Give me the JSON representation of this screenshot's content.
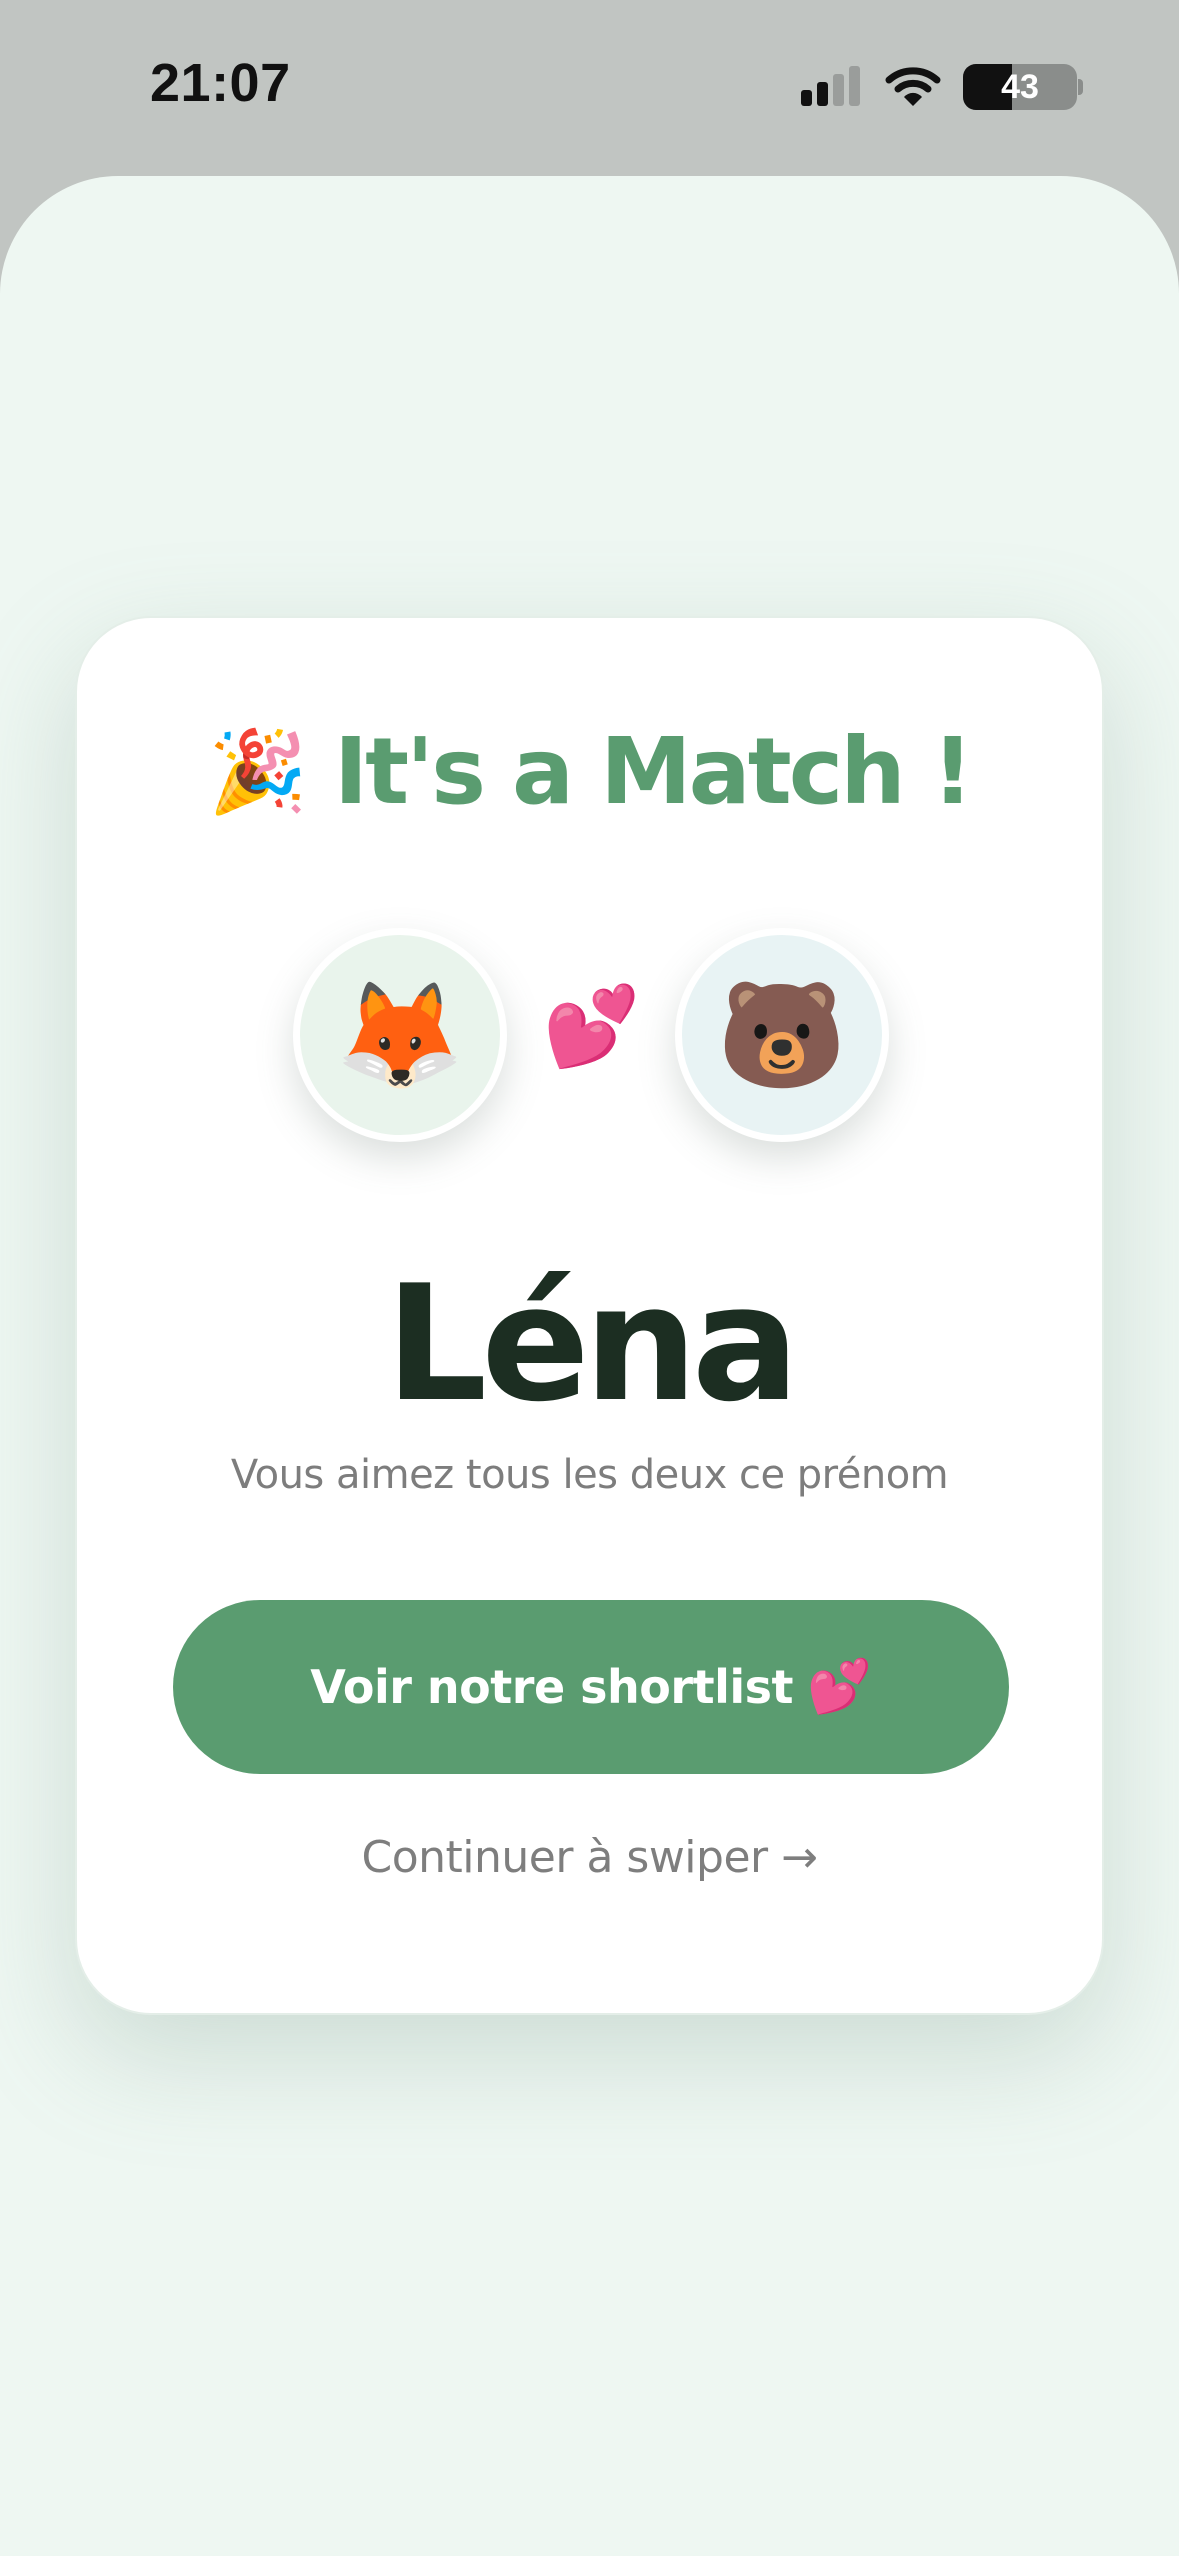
{
  "status_bar": {
    "time": "21:07",
    "battery_level": "43",
    "battery_fraction": 0.43,
    "icons": [
      "signal-icon",
      "wifi-icon",
      "battery-icon"
    ]
  },
  "match": {
    "title": "It's a Match !",
    "title_emoji": "🎉",
    "left_avatar_emoji": "🦊",
    "right_avatar_emoji": "🐻",
    "between_emoji": "💕",
    "name": "Léna",
    "subtitle": "Vous aimez tous les deux ce prénom",
    "primary_button_label": "Voir notre shortlist",
    "primary_button_emoji": "💕",
    "secondary_link_label": "Continuer à swiper →"
  },
  "colors": {
    "accent": "#5a9c70",
    "name_text": "#1c2e22",
    "sheet_background": "#eef7f2",
    "status_background": "#c1c5c2"
  }
}
